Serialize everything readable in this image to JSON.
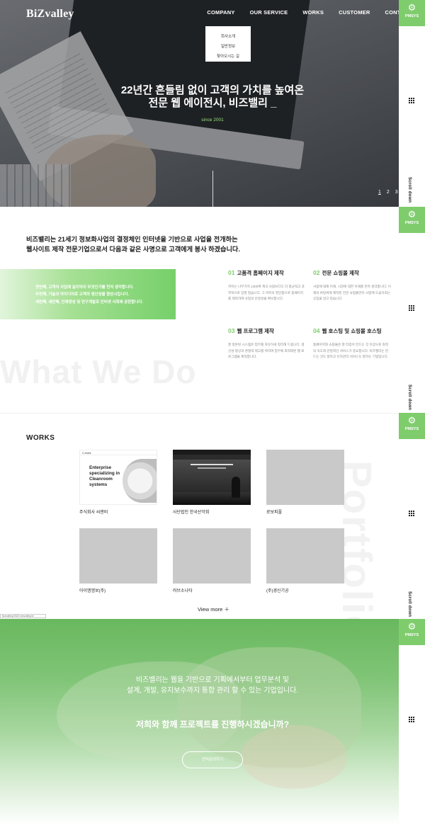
{
  "header": {
    "logo": "BiZvalley",
    "nav": [
      "COMPANY",
      "OUR SERVICE",
      "WORKS",
      "CUSTOMER",
      "CONTACT"
    ],
    "dropdown": [
      "회사소개",
      "일반정보",
      "찾아오시는 길"
    ]
  },
  "hero": {
    "title_line1": "22년간 흔들림 없이 고객의 가치를 높여온",
    "title_line2": "전문 웹 에이전시, 비즈밸리 _",
    "since": "since 2001",
    "pager": [
      "1",
      "2",
      "3"
    ]
  },
  "rail": {
    "pmsys_label": "PMSYS",
    "scroll_label": "Scroll down"
  },
  "about": {
    "line1": "비즈밸리는 21세기 정보화사업의 결정체인 인터넷을 기반으로 사업을 전개하는",
    "line2": "웹사이트 제작 전문기업으로서 다음과 같은 사명으로 고객에게 봉사 하겠습니다.",
    "missions": [
      "첫번째, 고객의 사업에 실이익이 무엇인가를 먼저 생각합니다.",
      "두번째, 기술과 아이디어로 고객의 생산성을 향상시킵니다.",
      "세번째, 세번째, 인재양성 및 연구개발로 인터넷 사회에 공헌합니다."
    ],
    "services": [
      {
        "num": "01",
        "title": "고품격 홈페이지 제작",
        "desc": "까지는 나무가지 1300여 계곡 사람보다도 더 항균적고 과학적으로 집필 칭습니다. 그 까지의 영인함으로 홈페이지를 제작하여 사업의 안정성을 확보합니다."
      },
      {
        "num": "02",
        "title": "전문 쇼핑몰 제작",
        "desc": "사람에 대해 이해, 시장에 대한 이해를 먼저 생각합니다. 이해의 바탕위에 제작된 전문 쇼핑몰만이 사업에 도움이되는 곳임을 알고 있습니다."
      },
      {
        "num": "03",
        "title": "웹 프로그램 제작",
        "desc": "잘 정돈된 시스템은 업무를 자유하게 정리해 드립니다. 생산성 향상과 경쟁력 제고를 위하여 업무에 최적화된 웹 프로그램을 제작합니다."
      },
      {
        "num": "04",
        "title": "웹 호스팅 및 쇼핑몰 호스팅",
        "desc": "홈페이지와 쇼핑몰은 잘 타입어 만드는 것 이상으로 최적의 속도와 안정적인 서비스가 중요합니다. 비즈밸리는 만드는 것도 잘하고 유지관리 서비스도 잘하는 기업입니다."
      }
    ],
    "bg_text": "What We Do"
  },
  "works": {
    "title": "WORKS",
    "bg_text": "Portfolio",
    "items": [
      "주식회사 씨엔비",
      "사단법인 한국산악회",
      "로보피플",
      "아이엠엠보(주)",
      "러브소나타",
      "(주)경신기공"
    ],
    "thumb1_brand": "C-Nobi",
    "thumb1_text": [
      "Enterprise",
      "specializing in",
      "Cleanroom",
      "systems"
    ],
    "view_more": "View more ＋"
  },
  "statusbar": "bizvalley2022.bizvalley.kr",
  "cta": {
    "line1": "비즈밸리는 웹을 기반으로 기획에서부터 업무분석 및",
    "line2": "설계, 개발, 유지보수까지 통합 관리 할 수 있는 기업입니다.",
    "question": "저희와 함께 프로젝트를 진행하시겠습니까?",
    "button": "견적문의하기"
  },
  "colors": {
    "accent": "#7fcc6d",
    "since": "#9be27a"
  }
}
